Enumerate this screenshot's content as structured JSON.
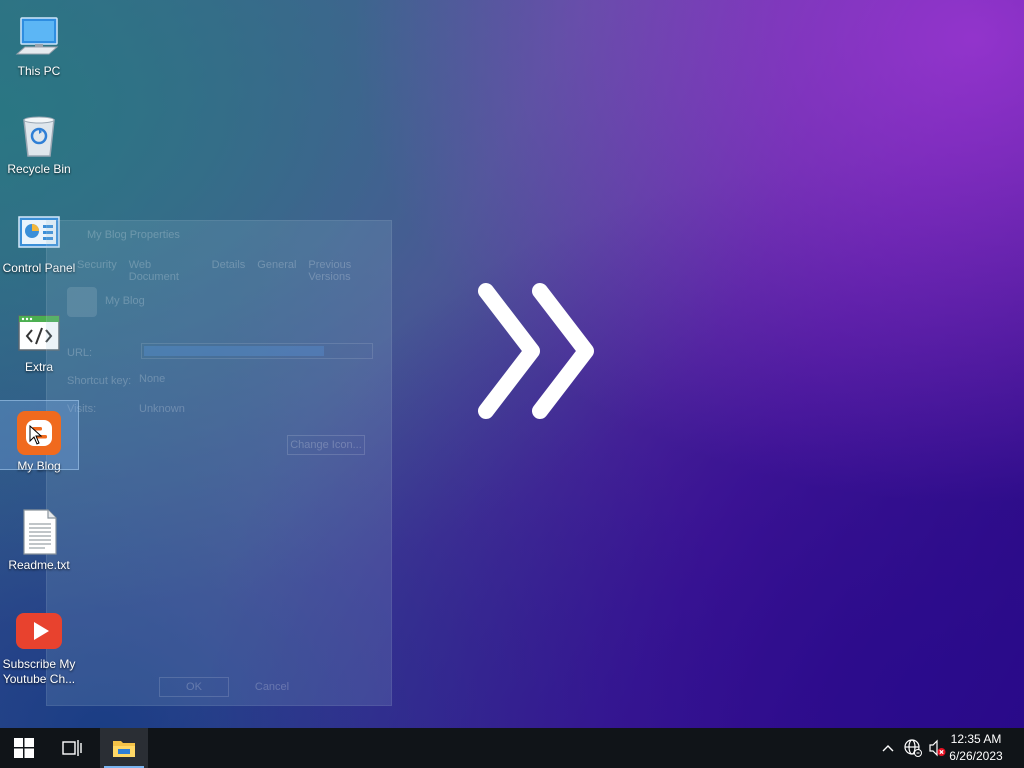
{
  "desktop_icons": [
    {
      "label": "This PC",
      "icon": "computer-icon"
    },
    {
      "label": "Recycle Bin",
      "icon": "recycle-bin-icon"
    },
    {
      "label": "Control Panel",
      "icon": "control-panel-icon"
    },
    {
      "label": "Extra",
      "icon": "code-window-icon"
    },
    {
      "label": "My Blog",
      "icon": "blogger-icon",
      "selected": true
    },
    {
      "label": "Readme.txt",
      "icon": "text-file-icon"
    },
    {
      "label": "Subscribe My Youtube Ch...",
      "icon": "youtube-icon"
    }
  ],
  "dialog": {
    "title": "My Blog Properties",
    "tabs": [
      "Security",
      "Web Document",
      "Details",
      "General",
      "Previous Versions"
    ],
    "item_name": "My Blog",
    "rows": [
      {
        "label": "URL:",
        "value": ""
      },
      {
        "label": "Shortcut key:",
        "value": "None"
      },
      {
        "label": "Visits:",
        "value": "Unknown"
      }
    ],
    "change_icon_label": "Change Icon...",
    "ok_label": "OK",
    "cancel_label": "Cancel"
  },
  "taskbar": {
    "start_icon": "windows-logo-icon",
    "task_view_icon": "task-view-icon",
    "pinned": [
      {
        "name": "File Explorer",
        "icon": "folder-icon",
        "active": true
      }
    ],
    "tray_icons": [
      "chevron-up-icon",
      "network-globe-icon",
      "volume-muted-icon"
    ],
    "time": "12:35 AM",
    "date": "6/26/2023"
  },
  "colors": {
    "taskbar_bg": "#101418",
    "accent": "#7ab4f0",
    "youtube_red": "#e8422e",
    "blogger_orange": "#f06a1e"
  }
}
